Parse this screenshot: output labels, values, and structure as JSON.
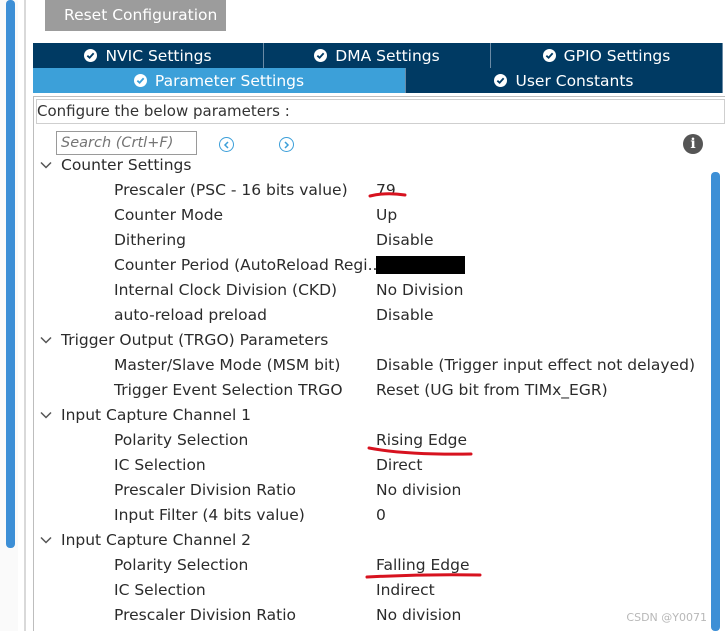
{
  "toolbar": {
    "reset_label": "Reset Configuration"
  },
  "tabs": [
    {
      "label": "NVIC Settings",
      "active": false
    },
    {
      "label": "DMA Settings",
      "active": false
    },
    {
      "label": "GPIO Settings",
      "active": false
    },
    {
      "label": "Parameter Settings",
      "active": true
    },
    {
      "label": "User Constants",
      "active": false
    }
  ],
  "panel": {
    "instruction": "Configure the below parameters :",
    "search_placeholder": "Search (Crtl+F)"
  },
  "groups": [
    {
      "label": "Counter Settings",
      "params": [
        {
          "name": "Prescaler (PSC - 16 bits value)",
          "value": "79"
        },
        {
          "name": "Counter Mode",
          "value": "Up"
        },
        {
          "name": "Dithering",
          "value": "Disable"
        },
        {
          "name": "Counter Period (AutoReload Regi...",
          "value": ""
        },
        {
          "name": "Internal Clock Division (CKD)",
          "value": "No Division"
        },
        {
          "name": "auto-reload preload",
          "value": "Disable"
        }
      ]
    },
    {
      "label": "Trigger Output (TRGO) Parameters",
      "params": [
        {
          "name": "Master/Slave Mode (MSM bit)",
          "value": "Disable (Trigger input effect not delayed)"
        },
        {
          "name": "Trigger Event Selection TRGO",
          "value": "Reset (UG bit from TIMx_EGR)"
        }
      ]
    },
    {
      "label": "Input Capture Channel 1",
      "params": [
        {
          "name": "Polarity Selection",
          "value": "Rising Edge"
        },
        {
          "name": "IC Selection",
          "value": "Direct"
        },
        {
          "name": "Prescaler Division Ratio",
          "value": "No division"
        },
        {
          "name": "Input Filter (4 bits value)",
          "value": "0"
        }
      ]
    },
    {
      "label": "Input Capture Channel 2",
      "params": [
        {
          "name": "Polarity Selection",
          "value": "Falling Edge"
        },
        {
          "name": "IC Selection",
          "value": "Indirect"
        },
        {
          "name": "Prescaler Division Ratio",
          "value": "No division"
        }
      ]
    }
  ],
  "watermark": "CSDN @Y0071",
  "colors": {
    "tab_dark": "#003a63",
    "tab_active": "#3ca0d9",
    "scroll_blue": "#3d8fd6",
    "annotation_red": "#d7121f"
  }
}
